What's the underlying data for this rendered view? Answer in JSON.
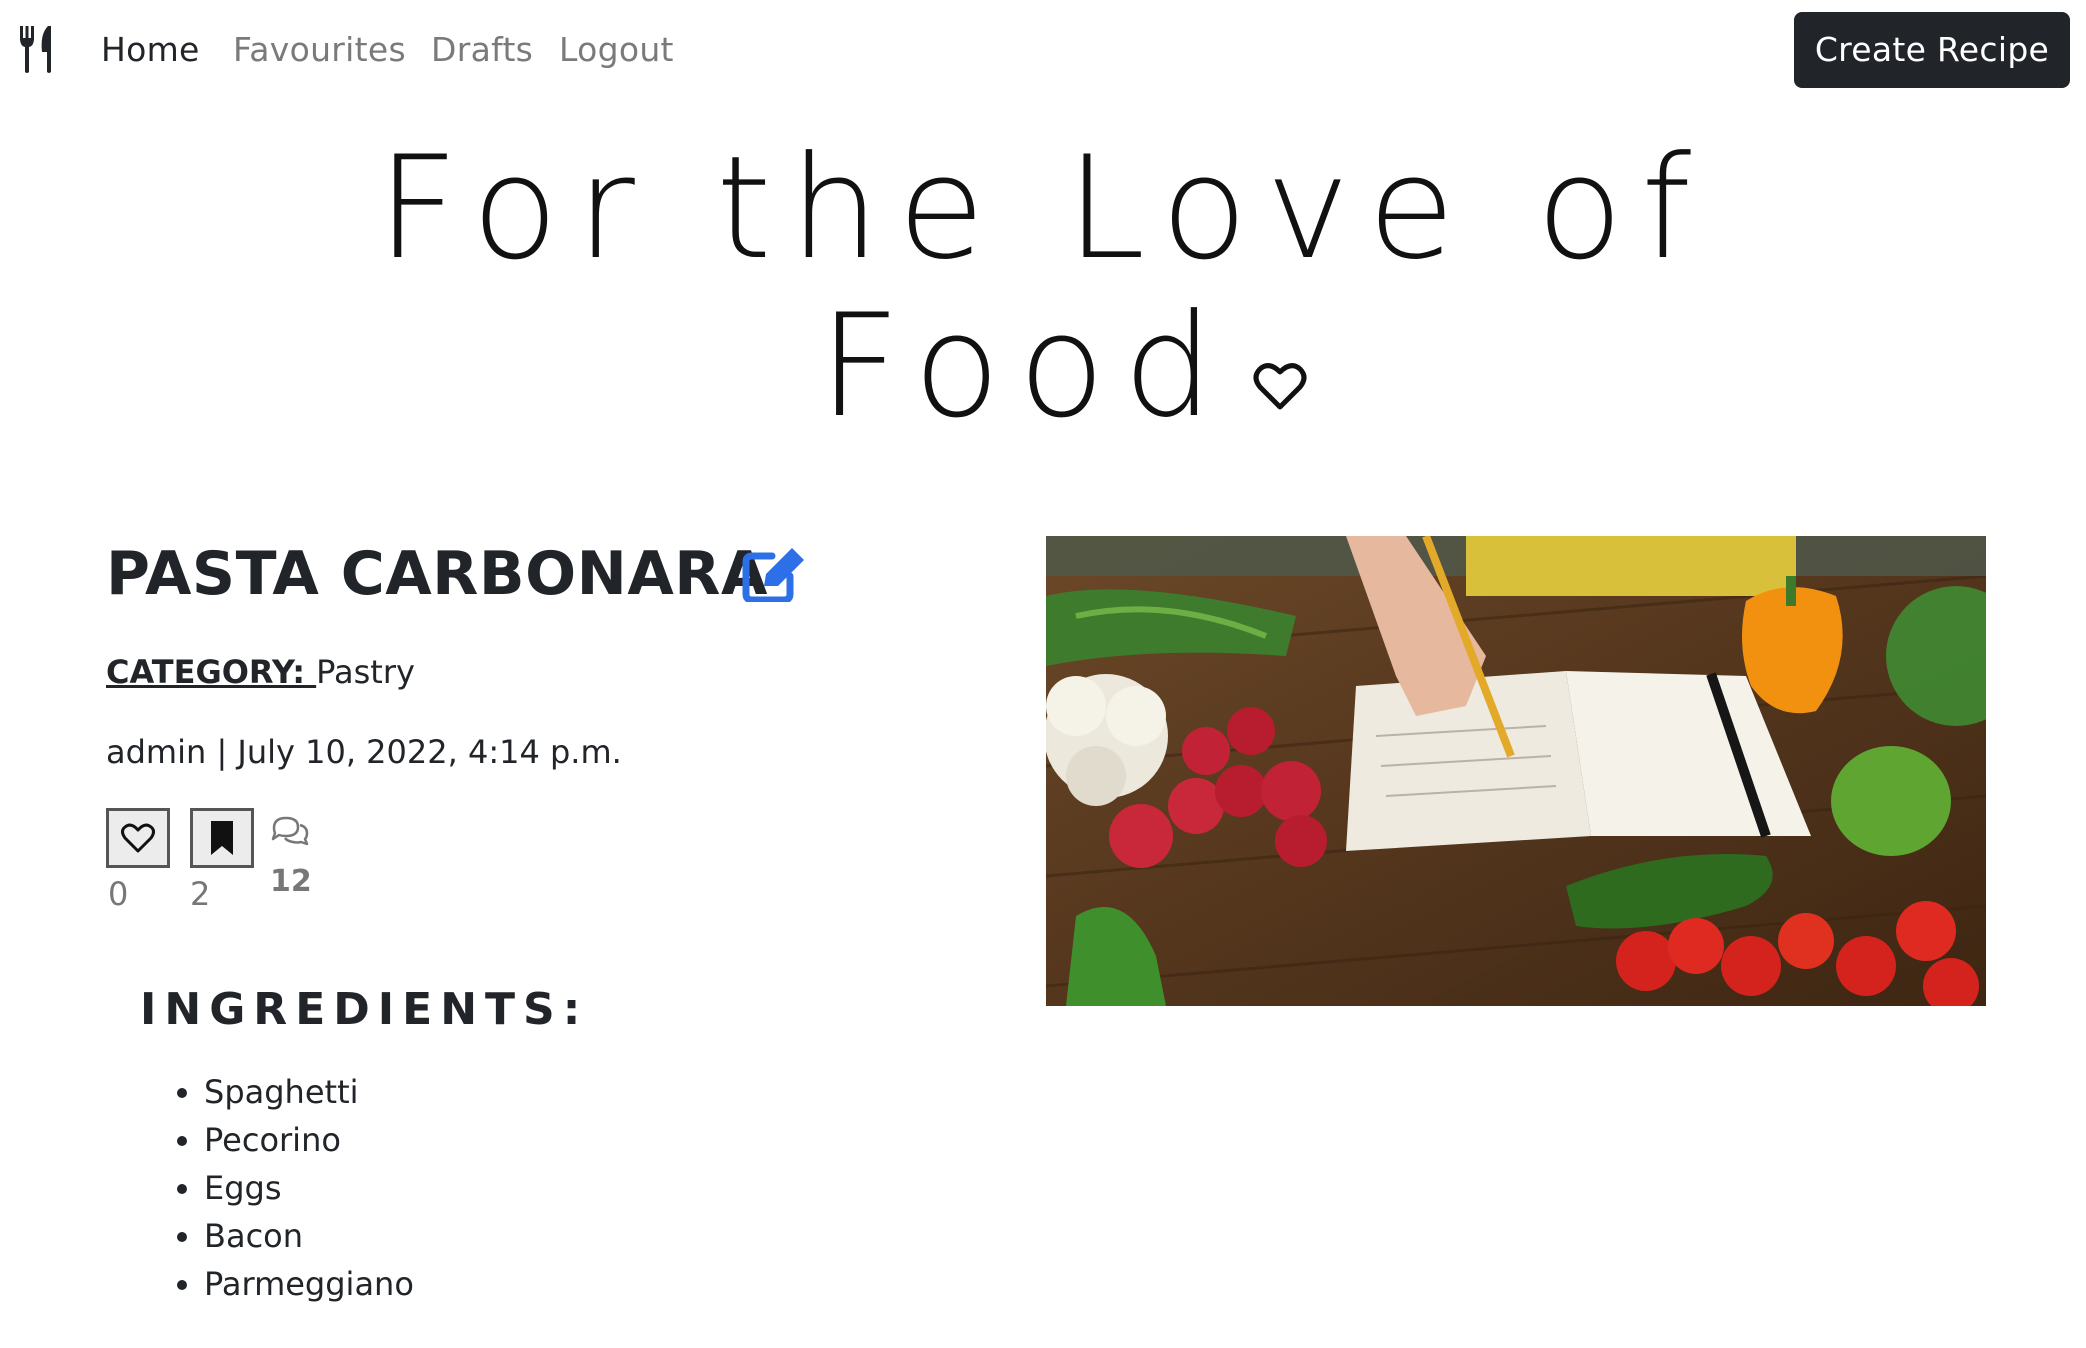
{
  "nav": {
    "logo_icon": "utensils-icon",
    "links": [
      "Home",
      "Favourites",
      "Drafts",
      "Logout"
    ],
    "active": "Home",
    "create_label": "Create Recipe"
  },
  "hero": {
    "line1": "For the Love of",
    "line2": "Food",
    "icon": "heart-outline-icon"
  },
  "recipe": {
    "title": "PASTA CARBONARA",
    "edit_icon": "edit-icon",
    "category_label": "CATEGORY: ",
    "category_value": "Pastry",
    "meta": "admin | July 10, 2022, 4:14 p.m.",
    "likes": "0",
    "saves": "2",
    "comments": "12",
    "ingredients_title": "INGREDIENTS:",
    "ingredients": [
      "Spaghetti",
      "Pecorino",
      "Eggs",
      "Bacon",
      "Parmeggiano"
    ]
  },
  "colors": {
    "accent_blue": "#2d6fe6",
    "dark_button": "#212529"
  }
}
